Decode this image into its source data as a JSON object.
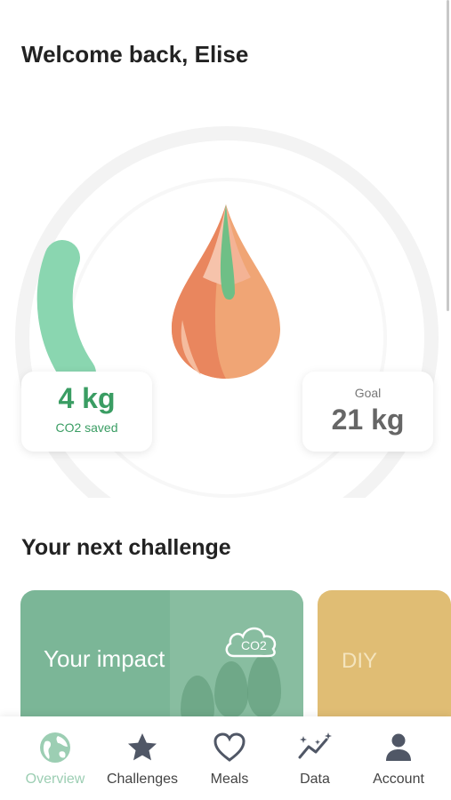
{
  "greeting": {
    "prefix": "Welcome back, ",
    "name": "Elise"
  },
  "progress": {
    "saved_value": "4 kg",
    "saved_label": "CO2 saved",
    "goal_label": "Goal",
    "goal_value": "21 kg",
    "fraction": 0.19,
    "accent": "#8ad6b0"
  },
  "section": {
    "title_strong": "Your",
    "title_rest": " next challenge"
  },
  "challenges": [
    {
      "title": "Your impact",
      "badge": "CO2",
      "color": "#7bb697"
    },
    {
      "title": "DIY",
      "color": "#e0bd74"
    }
  ],
  "tabs": [
    {
      "label": "Overview",
      "icon": "globe-icon",
      "active": true
    },
    {
      "label": "Challenges",
      "icon": "star-icon"
    },
    {
      "label": "Meals",
      "icon": "heart-icon"
    },
    {
      "label": "Data",
      "icon": "sparkle-chart-icon"
    },
    {
      "label": "Account",
      "icon": "person-icon"
    }
  ]
}
